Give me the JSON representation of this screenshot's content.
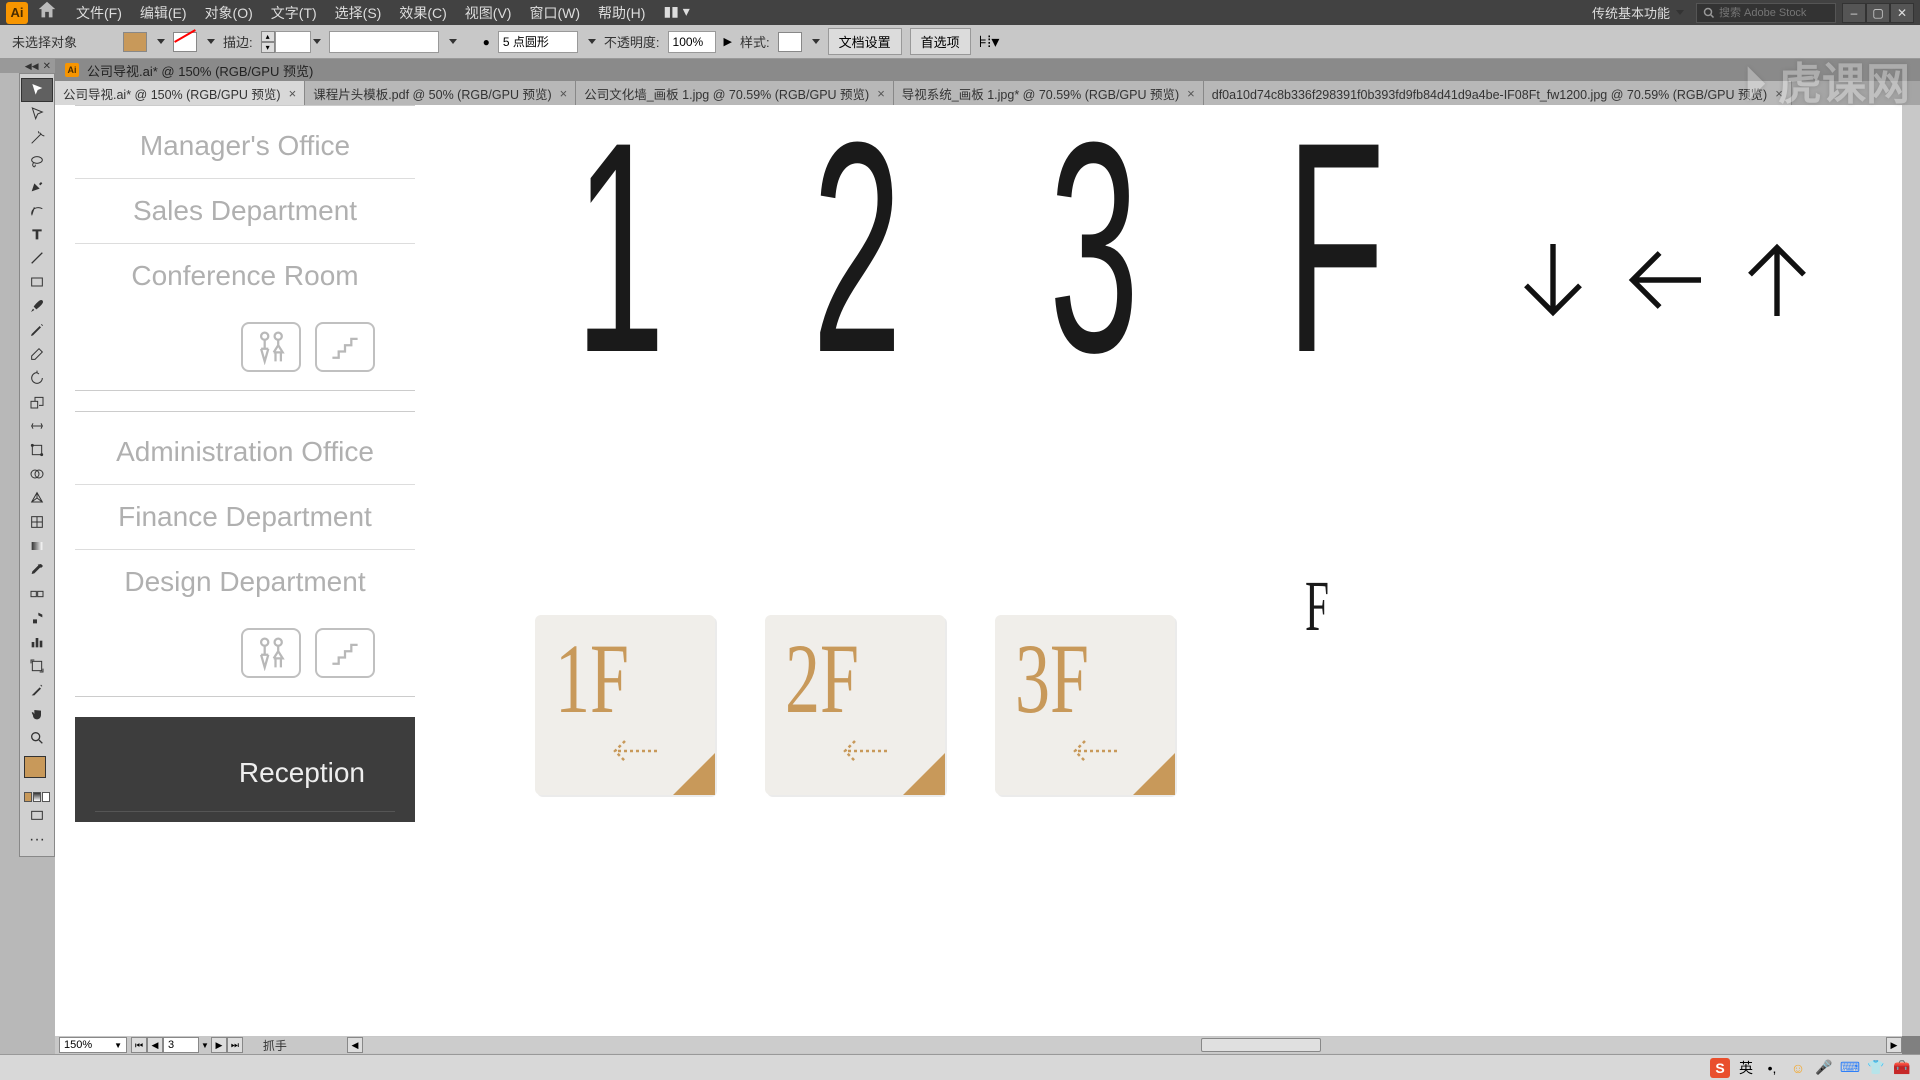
{
  "app": {
    "logo": "Ai"
  },
  "menubar": {
    "items": [
      "文件(F)",
      "编辑(E)",
      "对象(O)",
      "文字(T)",
      "选择(S)",
      "效果(C)",
      "视图(V)",
      "窗口(W)",
      "帮助(H)"
    ],
    "workspace": "传统基本功能",
    "search_placeholder": "搜索 Adobe Stock"
  },
  "options": {
    "no_selection": "未选择对象",
    "stroke_label": "描边:",
    "brush_pt": "5 点圆形",
    "opacity_label": "不透明度:",
    "opacity_value": "100%",
    "style_label": "样式:",
    "doc_setup": "文档设置",
    "prefs": "首选项"
  },
  "doc_title": "公司导视.ai* @ 150% (RGB/GPU 预览)",
  "tabs": [
    {
      "label": "公司导视.ai* @ 150% (RGB/GPU 预览)",
      "active": true
    },
    {
      "label": "课程片头模板.pdf @ 50% (RGB/GPU 预览)",
      "active": false
    },
    {
      "label": "公司文化墙_画板 1.jpg @ 70.59% (RGB/GPU 预览)",
      "active": false
    },
    {
      "label": "导视系统_画板 1.jpg* @ 70.59% (RGB/GPU 预览)",
      "active": false
    },
    {
      "label": "df0a10d74c8b336f298391f0b393fd9fb84d41d9a4be-IF08Ft_fw1200.jpg @ 70.59% (RGB/GPU 预览)",
      "active": false
    }
  ],
  "artwork": {
    "rooms_a": [
      "Manager's Office",
      "Sales Department",
      "Conference Room"
    ],
    "rooms_b": [
      "Administration Office",
      "Finance Department",
      "Design Department"
    ],
    "reception": "Reception",
    "big_chars": [
      "1",
      "2",
      "3",
      "F"
    ],
    "small_f": "F",
    "cards": [
      "1F",
      "2F",
      "3F"
    ]
  },
  "footer": {
    "zoom": "150%",
    "artboard": "3",
    "tool_hint": "抓手"
  },
  "taskbar": {
    "ime": "英"
  },
  "colors": {
    "accent": "#c8995a",
    "dark_panel": "#3d3d3d"
  },
  "watermark": "虎课网"
}
